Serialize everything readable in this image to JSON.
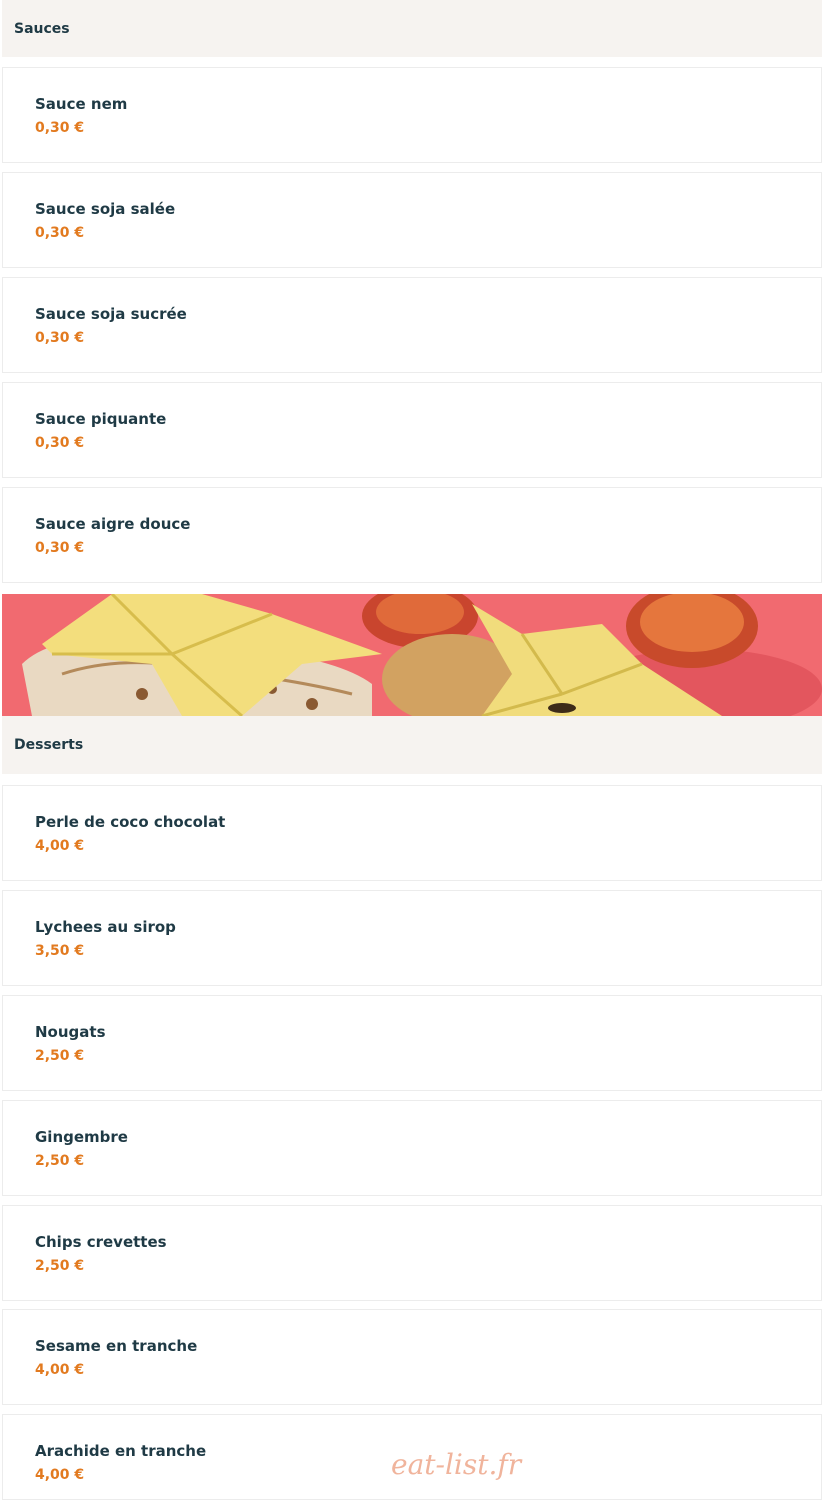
{
  "sections": {
    "sauces": {
      "title": "Sauces",
      "items": [
        {
          "name": "Sauce nem",
          "price": "0,30 €"
        },
        {
          "name": "Sauce soja salée",
          "price": "0,30 €"
        },
        {
          "name": "Sauce soja sucrée",
          "price": "0,30 €"
        },
        {
          "name": "Sauce piquante",
          "price": "0,30 €"
        },
        {
          "name": "Sauce aigre douce",
          "price": "0,30 €"
        }
      ]
    },
    "desserts": {
      "title": "Desserts",
      "items": [
        {
          "name": "Perle de coco chocolat",
          "price": "4,00 €"
        },
        {
          "name": "Lychees au sirop",
          "price": "3,50 €"
        },
        {
          "name": "Nougats",
          "price": "2,50 €"
        },
        {
          "name": "Gingembre",
          "price": "2,50 €"
        },
        {
          "name": "Chips crevettes",
          "price": "2,50 €"
        },
        {
          "name": "Sesame en tranche",
          "price": "4,00 €"
        },
        {
          "name": "Arachide en tranche",
          "price": "4,00 €"
        }
      ]
    }
  },
  "watermark": "eat-list.fr",
  "colors": {
    "header_bg": "#f6f3f0",
    "title_text": "#1f3a45",
    "price_text": "#e27a1f",
    "watermark": "#f0b49c"
  }
}
